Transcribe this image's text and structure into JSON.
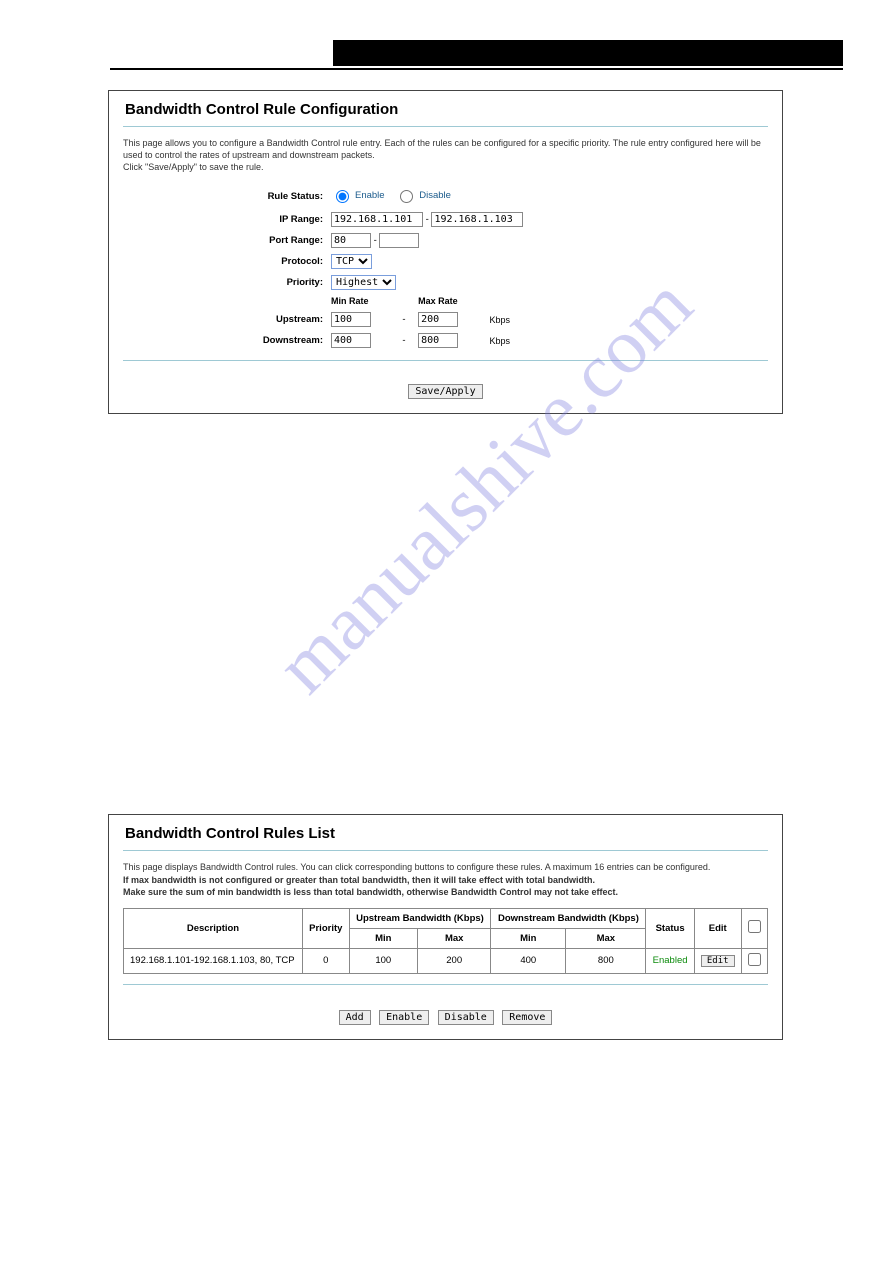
{
  "watermark": "manualshive.com",
  "panel1": {
    "title": "Bandwidth Control Rule Configuration",
    "desc_line1": "This page allows you to configure a Bandwidth Control rule entry. Each of the rules can be configured for a specific priority. The rule entry configured here will be used to control the rates of upstream and downstream packets.",
    "desc_line2": "Click \"Save/Apply\" to save the rule.",
    "labels": {
      "rule_status": "Rule Status:",
      "ip_range": "IP Range:",
      "port_range": "Port Range:",
      "protocol": "Protocol:",
      "priority": "Priority:",
      "upstream": "Upstream:",
      "downstream": "Downstream:"
    },
    "radio": {
      "enable": "Enable",
      "disable": "Disable"
    },
    "values": {
      "ip_from": "192.168.1.101",
      "ip_to": "192.168.1.103",
      "port_from": "80",
      "port_to": "",
      "protocol_sel": "TCP",
      "priority_sel": "Highest",
      "rate_hdr_min": "Min Rate",
      "rate_hdr_max": "Max Rate",
      "up_min": "100",
      "up_max": "200",
      "dn_min": "400",
      "dn_max": "800",
      "unit": "Kbps"
    },
    "dash": "-",
    "save_btn": "Save/Apply"
  },
  "panel2": {
    "title": "Bandwidth Control Rules List",
    "desc_line1": "This page displays Bandwidth Control rules. You can click corresponding buttons to configure these rules. A maximum 16 entries can be configured.",
    "desc_b1": "If max bandwidth is not configured or greater than total bandwidth, then it will take effect with total bandwidth.",
    "desc_b2": "Make sure the sum of min bandwidth is less than total bandwidth, otherwise Bandwidth Control may not take effect.",
    "headers": {
      "description": "Description",
      "priority": "Priority",
      "up_group": "Upstream Bandwidth (Kbps)",
      "dn_group": "Downstream Bandwidth (Kbps)",
      "min": "Min",
      "max": "Max",
      "status": "Status",
      "edit": "Edit"
    },
    "row": {
      "desc": "192.168.1.101-192.168.1.103, 80, TCP",
      "priority": "0",
      "up_min": "100",
      "up_max": "200",
      "dn_min": "400",
      "dn_max": "800",
      "status": "Enabled",
      "edit_btn": "Edit"
    },
    "buttons": {
      "add": "Add",
      "enable": "Enable",
      "disable": "Disable",
      "remove": "Remove"
    }
  }
}
